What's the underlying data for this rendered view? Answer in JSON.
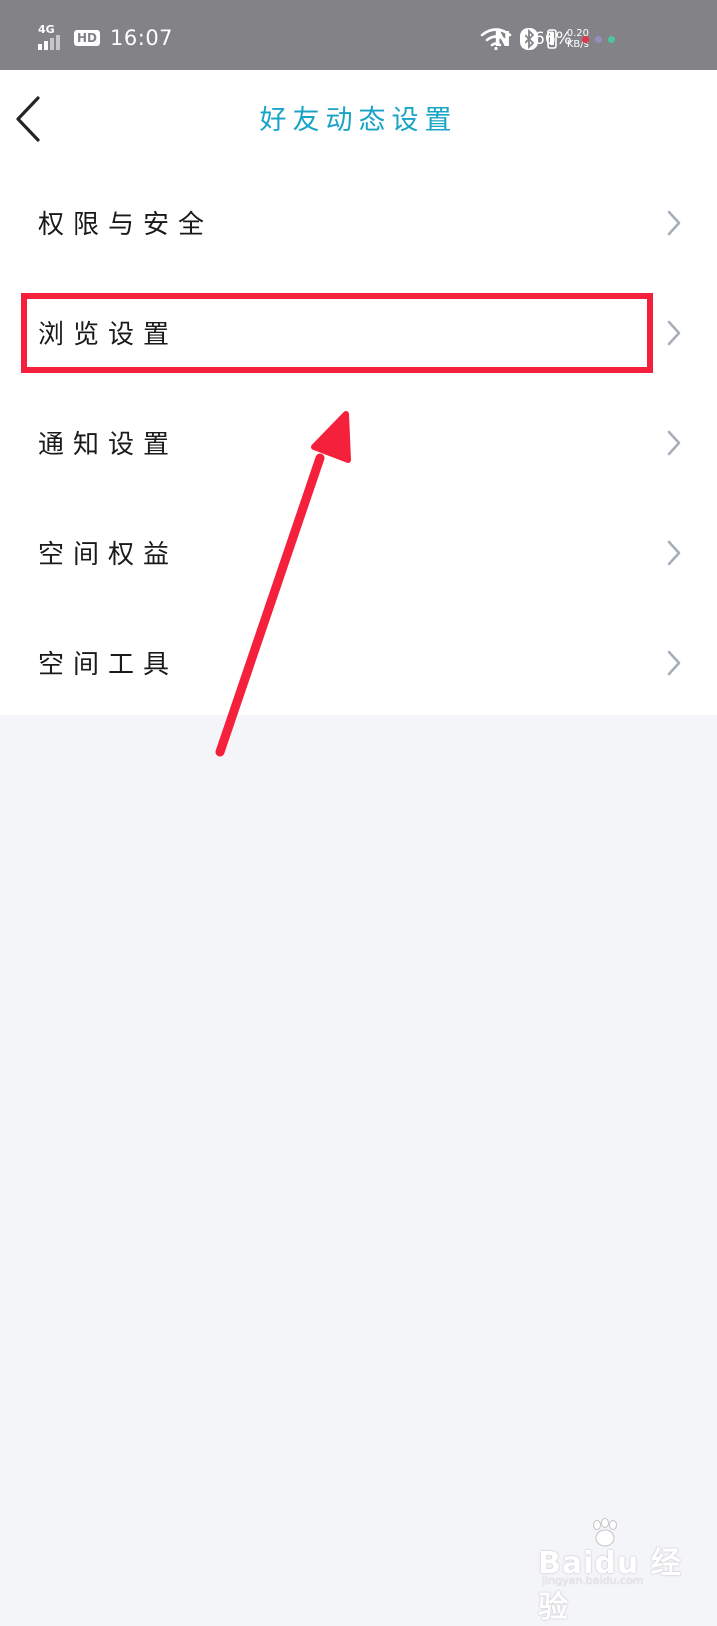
{
  "status_bar": {
    "network": "4G",
    "hd": "HD",
    "time": "16:07",
    "nfc": "N",
    "net_speed_value": "0.20",
    "net_speed_unit": "KB/s",
    "battery": "66%"
  },
  "nav": {
    "title": "好友动态设置"
  },
  "menu": {
    "items": [
      {
        "label": "权限与安全"
      },
      {
        "label": "浏览设置"
      },
      {
        "label": "通知设置"
      },
      {
        "label": "空间权益"
      },
      {
        "label": "空间工具"
      }
    ]
  },
  "annotation": {
    "highlight_color": "#f5203b",
    "highlighted_item": "浏览设置"
  },
  "watermark": {
    "brand": "Bai",
    "brand2": "du",
    "product": "经验",
    "url": "jingyan.baidu.com"
  },
  "colors": {
    "status_bar_bg": "#838286",
    "title_color": "#19a4c7",
    "page_bg": "#f4f5f9",
    "chevron": "#a7aeb9"
  }
}
